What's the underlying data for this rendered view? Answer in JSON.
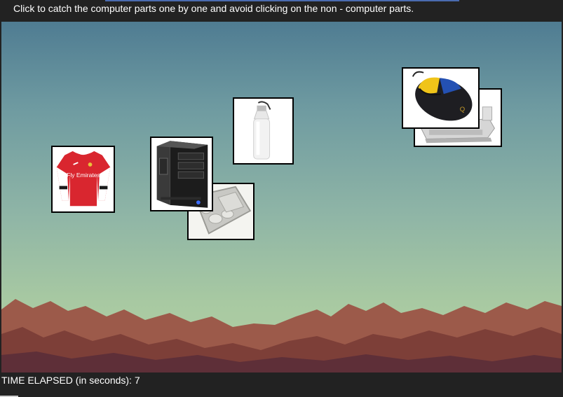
{
  "instructions": "Click to catch the computer parts one by one and avoid clicking on the non - computer parts.",
  "status": {
    "label": "TIME ELAPSED (in seconds): ",
    "value": "7"
  },
  "colors": {
    "bar": "#222222",
    "sky_top": "#4f7c92",
    "sky_bottom": "#b2cfa1",
    "mountain": "#8a4a3e"
  },
  "items": [
    {
      "name": "football-jersey",
      "icon": "jersey-icon",
      "computer_part": false,
      "jersey_text": "Fly Emirates"
    },
    {
      "name": "cpu-tower",
      "icon": "cpu-tower-icon",
      "computer_part": true
    },
    {
      "name": "steel-tray",
      "icon": "tray-icon",
      "computer_part": false
    },
    {
      "name": "water-bottle",
      "icon": "bottle-icon",
      "computer_part": false
    },
    {
      "name": "printer",
      "icon": "printer-icon",
      "computer_part": true
    },
    {
      "name": "mouse",
      "icon": "mouse-icon",
      "computer_part": true
    }
  ]
}
